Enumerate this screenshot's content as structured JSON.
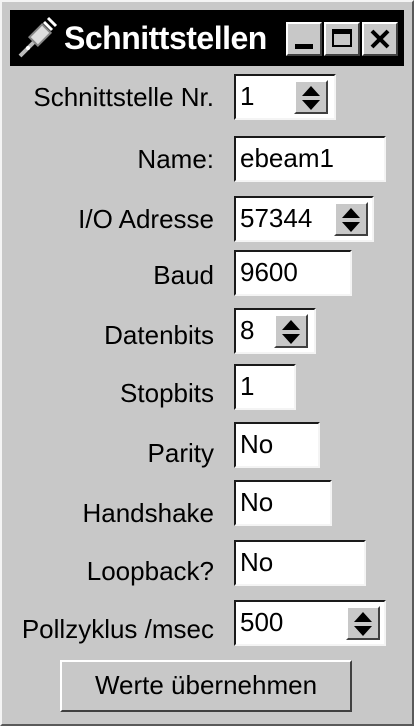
{
  "window": {
    "title": "Schnittstellen",
    "icon": "plug-icon",
    "controls": [
      "minimize-icon",
      "maximize-icon",
      "close-icon"
    ]
  },
  "form": {
    "schnittstelle_nr": {
      "label": "Schnittstelle Nr.",
      "value": "1"
    },
    "name": {
      "label": "Name:",
      "value": "ebeam1"
    },
    "io_adresse": {
      "label": "I/O Adresse",
      "value": "57344"
    },
    "baud": {
      "label": "Baud",
      "value": "9600"
    },
    "datenbits": {
      "label": "Datenbits",
      "value": "8"
    },
    "stopbits": {
      "label": "Stopbits",
      "value": "1"
    },
    "parity": {
      "label": "Parity",
      "value": "No"
    },
    "handshake": {
      "label": "Handshake",
      "value": "No"
    },
    "loopback": {
      "label": "Loopback?",
      "value": "No"
    },
    "pollzyklus": {
      "label": "Pollzyklus /msec",
      "value": "500"
    }
  },
  "apply_button": {
    "label": "Werte übernehmen"
  }
}
